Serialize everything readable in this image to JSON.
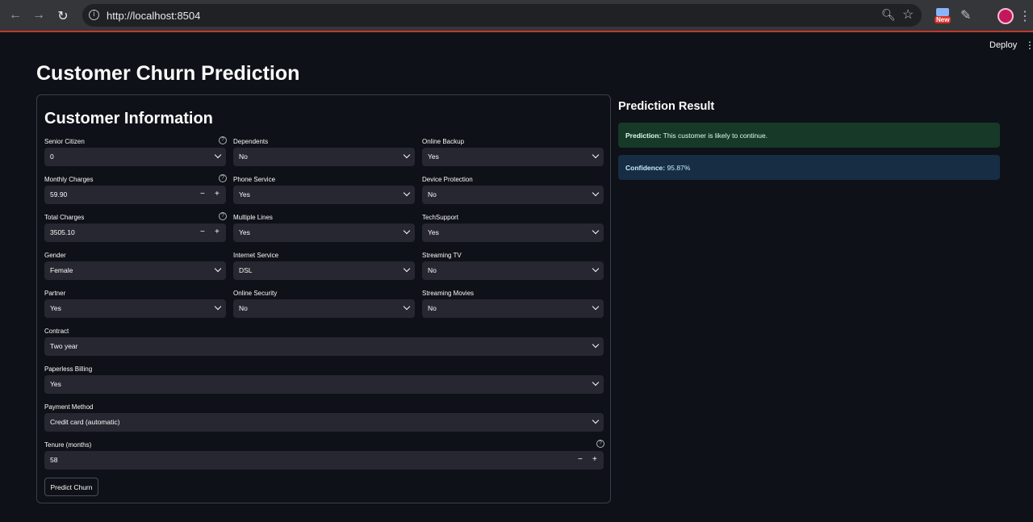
{
  "browser": {
    "url": "http://localhost:8504",
    "ext_badge": "New"
  },
  "app": {
    "deploy_label": "Deploy",
    "title": "Customer Churn Prediction"
  },
  "form": {
    "title": "Customer Information",
    "senior_citizen": {
      "label": "Senior Citizen",
      "value": "0"
    },
    "monthly_charges": {
      "label": "Monthly Charges",
      "value": "59.90"
    },
    "total_charges": {
      "label": "Total Charges",
      "value": "3505.10"
    },
    "gender": {
      "label": "Gender",
      "value": "Female"
    },
    "partner": {
      "label": "Partner",
      "value": "Yes"
    },
    "dependents": {
      "label": "Dependents",
      "value": "No"
    },
    "phone_service": {
      "label": "Phone Service",
      "value": "Yes"
    },
    "multiple_lines": {
      "label": "Multiple Lines",
      "value": "Yes"
    },
    "internet_service": {
      "label": "Internet Service",
      "value": "DSL"
    },
    "online_security": {
      "label": "Online Security",
      "value": "No"
    },
    "online_backup": {
      "label": "Online Backup",
      "value": "Yes"
    },
    "device_protection": {
      "label": "Device Protection",
      "value": "No"
    },
    "tech_support": {
      "label": "TechSupport",
      "value": "Yes"
    },
    "streaming_tv": {
      "label": "Streaming TV",
      "value": "No"
    },
    "streaming_movies": {
      "label": "Streaming Movies",
      "value": "No"
    },
    "contract": {
      "label": "Contract",
      "value": "Two year"
    },
    "paperless_billing": {
      "label": "Paperless Billing",
      "value": "Yes"
    },
    "payment_method": {
      "label": "Payment Method",
      "value": "Credit card (automatic)"
    },
    "tenure": {
      "label": "Tenure (months)",
      "value": "58"
    },
    "predict_button": "Predict Churn"
  },
  "result": {
    "title": "Prediction Result",
    "prediction_label": "Prediction:",
    "prediction_text": "This customer is likely to continue.",
    "confidence_label": "Confidence:",
    "confidence_value": "95.87%"
  },
  "colors": {
    "background": "#0e1117",
    "input_bg": "#262730",
    "success_bg": "#173928",
    "info_bg": "#172d43"
  }
}
